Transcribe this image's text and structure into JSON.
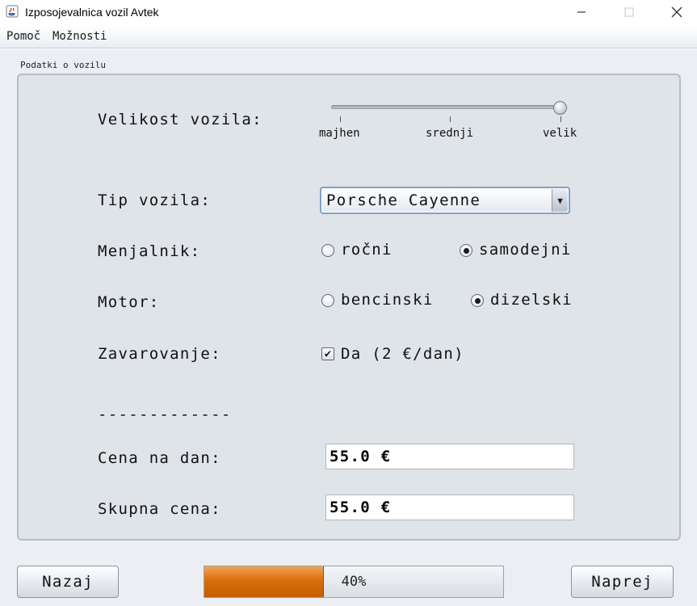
{
  "window": {
    "title": "Izposojevalnica vozil Avtek"
  },
  "menu": {
    "items": [
      "Pomoč",
      "Možnosti"
    ]
  },
  "group": {
    "title": "Podatki o vozilu"
  },
  "size": {
    "label": "Velikost vozila:",
    "ticks": [
      "majhen",
      "srednji",
      "velik"
    ],
    "selected": "velik"
  },
  "type": {
    "label": "Tip vozila:",
    "selected": "Porsche Cayenne"
  },
  "transmission": {
    "label": "Menjalnik:",
    "options": [
      "ročni",
      "samodejni"
    ],
    "selected": "samodejni"
  },
  "engine": {
    "label": "Motor:",
    "options": [
      "bencinski",
      "dizelski"
    ],
    "selected": "dizelski"
  },
  "insurance": {
    "label": "Zavarovanje:",
    "checkbox_label": "Da (2 €/dan)",
    "checked": true
  },
  "separator": "-------------",
  "price_per_day": {
    "label": "Cena na dan:",
    "value": "55.0 €"
  },
  "total_price": {
    "label": "Skupna cena:",
    "value": "55.0 €"
  },
  "footer": {
    "back_label": "Nazaj",
    "next_label": "Naprej",
    "progress_text": "40%",
    "progress_value": 0.4
  },
  "colors": {
    "progress_fill": "#d96f0c",
    "combo_border": "#7fa2c8"
  }
}
